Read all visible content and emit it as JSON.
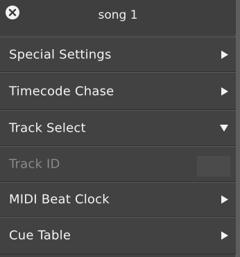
{
  "window": {
    "title": "song 1",
    "close_icon": "close-icon"
  },
  "menu": {
    "items": [
      {
        "label": "Special Settings",
        "state": "collapsed",
        "icon": "chevron-right-icon"
      },
      {
        "label": "Timecode Chase",
        "state": "collapsed",
        "icon": "chevron-right-icon"
      },
      {
        "label": "Track Select",
        "state": "expanded",
        "icon": "chevron-down-icon"
      },
      {
        "label": "Track ID",
        "state": "disabled"
      },
      {
        "label": "MIDI Beat Clock",
        "state": "collapsed",
        "icon": "chevron-right-icon"
      },
      {
        "label": "Cue Table",
        "state": "collapsed",
        "icon": "chevron-right-icon"
      }
    ]
  },
  "colors": {
    "background": "#424242",
    "text": "#f3f3f3",
    "disabled_text": "#8a8a8a"
  }
}
